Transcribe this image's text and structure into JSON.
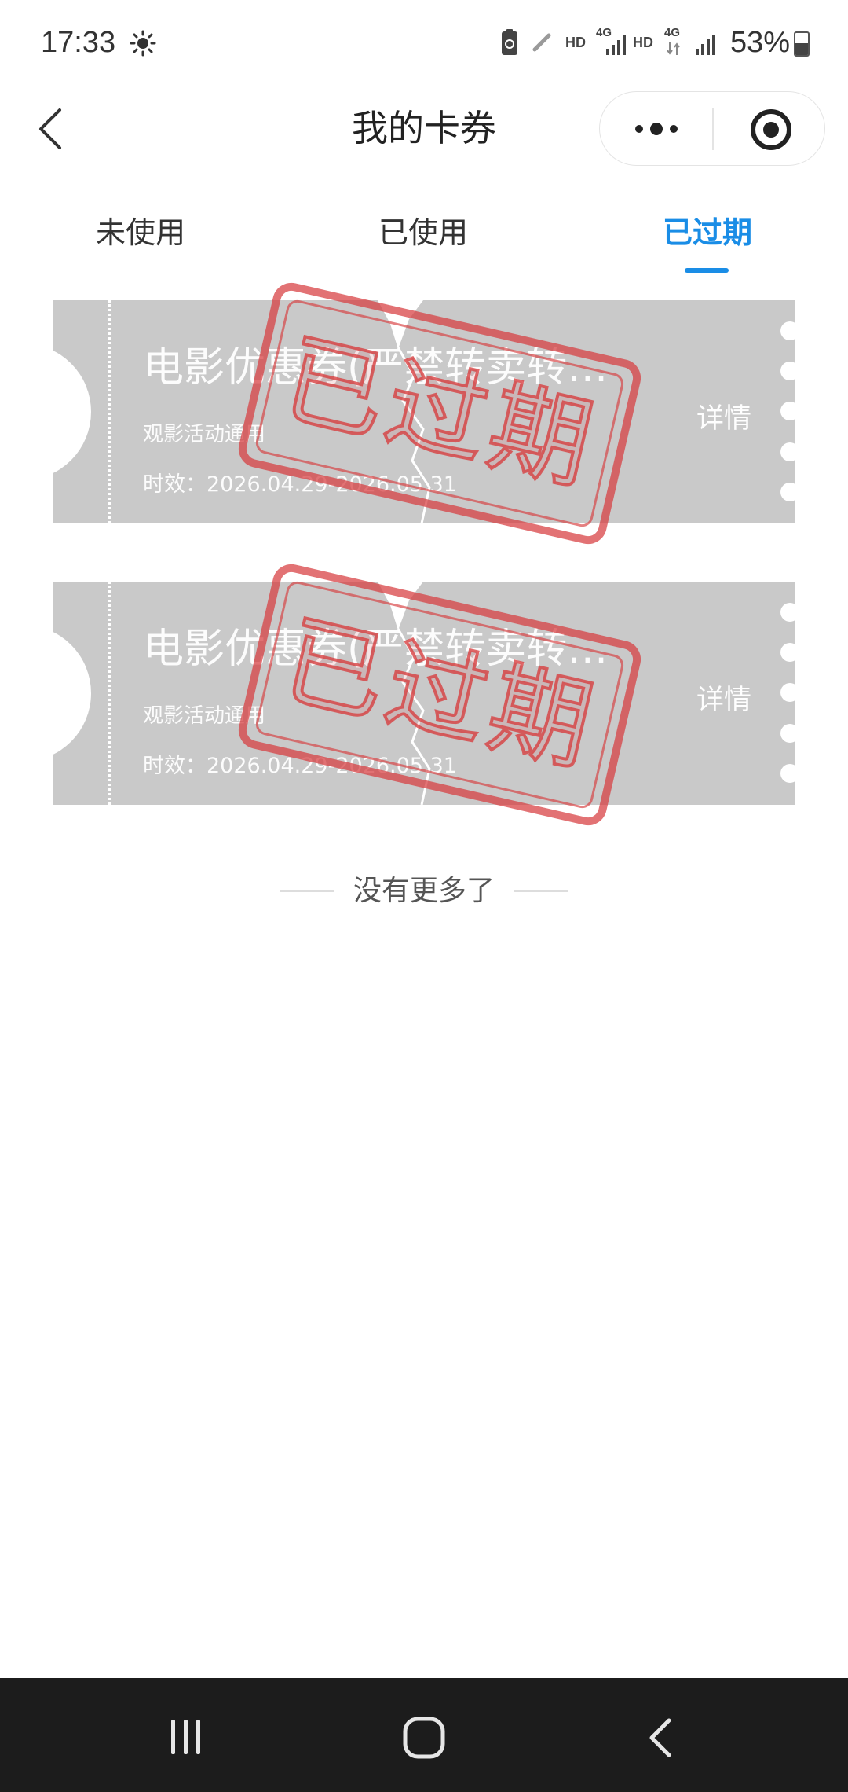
{
  "status_bar": {
    "time": "17:33",
    "hd_1": "HD",
    "lte_1": "4G",
    "hd_2": "HD",
    "lte_2": "4G",
    "battery": "53%",
    "battery_level": 0.53,
    "icons": [
      "brightness-icon",
      "battery-saver-icon",
      "pen-icon",
      "signal-icon",
      "signal-icon",
      "battery-icon"
    ]
  },
  "header": {
    "title": "我的卡券",
    "back_icon": "chevron-left-icon",
    "more_icon": "more-dots-icon",
    "close_icon": "target-circle-icon"
  },
  "tabs": [
    {
      "label": "未使用",
      "active": false
    },
    {
      "label": "已使用",
      "active": false
    },
    {
      "label": "已过期",
      "active": true
    }
  ],
  "coupons": [
    {
      "title": "电影优惠券(严禁转卖转…",
      "subtitle": "观影活动通用",
      "validity": "时效：2026.04.29-2026.05.31",
      "detail": "详情",
      "stamp": "已过期"
    },
    {
      "title": "电影优惠券(严禁转卖转…",
      "subtitle": "观影活动通用",
      "validity": "时效：2026.04.29-2026.05.31",
      "detail": "详情",
      "stamp": "已过期"
    }
  ],
  "footer": {
    "no_more": "没有更多了"
  },
  "colors": {
    "accent": "#1a8de6",
    "coupon_expired": "#c9c9c9",
    "stamp": "#d73c3e",
    "navbar": "#1c1c1c"
  }
}
